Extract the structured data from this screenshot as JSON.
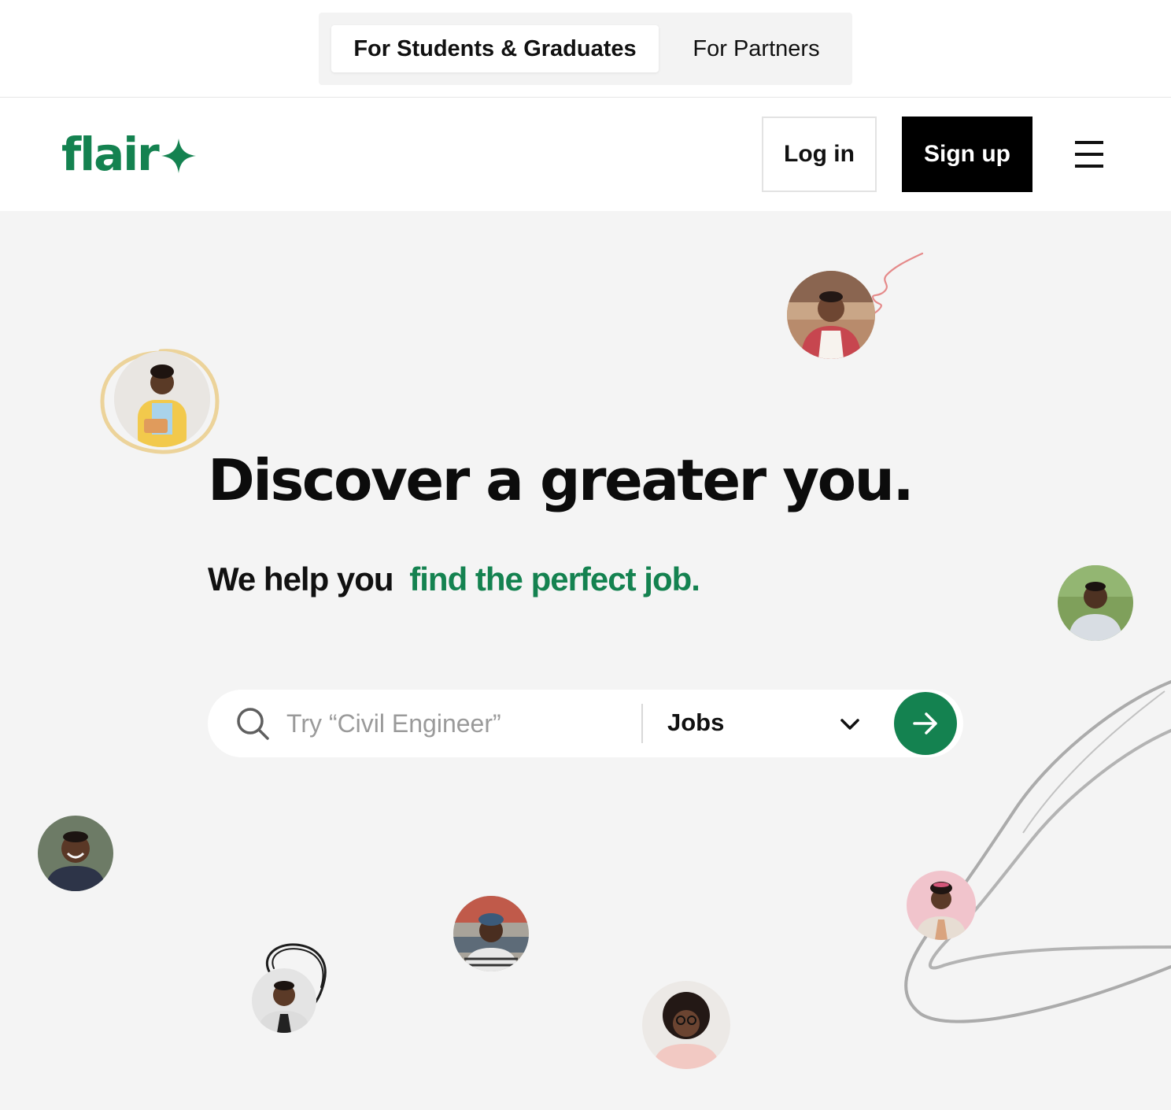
{
  "audience_switcher": {
    "active_tab": "For Students & Graduates",
    "other_tab": "For Partners"
  },
  "header": {
    "logo_text": "flair",
    "login_label": "Log in",
    "signup_label": "Sign up"
  },
  "hero": {
    "headline": "Discover a greater you.",
    "subline_plain": "We help you",
    "subline_accent": "find the perfect job."
  },
  "search": {
    "placeholder": "Try “Civil Engineer”",
    "value": "",
    "category_selected": "Jobs"
  },
  "colors": {
    "brand_green": "#148250",
    "hero_background": "#f4f4f4"
  },
  "icons": [
    "star-sparkle-icon",
    "menu-icon",
    "search-icon",
    "chevron-down-icon",
    "arrow-right-icon"
  ]
}
